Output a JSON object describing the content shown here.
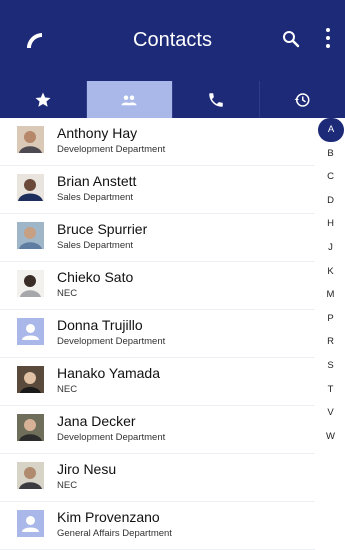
{
  "appbar": {
    "title": "Contacts",
    "call_icon": "call-handset-icon",
    "search_icon": "search-icon",
    "menu_icon": "more-vert-icon",
    "background": "#1d2a78"
  },
  "tabs": [
    {
      "icon": "star-icon",
      "active": false
    },
    {
      "icon": "people-icon",
      "active": true
    },
    {
      "icon": "phone-icon",
      "active": false
    },
    {
      "icon": "history-icon",
      "active": false
    }
  ],
  "contacts": [
    {
      "name": "Anthony Hay",
      "dept": "Development Department",
      "avatar": "photo"
    },
    {
      "name": "Brian Anstett",
      "dept": "Sales Department",
      "avatar": "photo"
    },
    {
      "name": "Bruce Spurrier",
      "dept": "Sales Department",
      "avatar": "photo"
    },
    {
      "name": "Chieko Sato",
      "dept": "NEC",
      "avatar": "photo"
    },
    {
      "name": "Donna Trujillo",
      "dept": "Development Department",
      "avatar": "placeholder"
    },
    {
      "name": "Hanako Yamada",
      "dept": "NEC",
      "avatar": "photo"
    },
    {
      "name": "Jana Decker",
      "dept": "Development Department",
      "avatar": "photo"
    },
    {
      "name": "Jiro Nesu",
      "dept": "NEC",
      "avatar": "photo"
    },
    {
      "name": "Kim Provenzano",
      "dept": "General Affairs Department",
      "avatar": "placeholder"
    }
  ],
  "index_letters": [
    "A",
    "B",
    "C",
    "D",
    "H",
    "J",
    "K",
    "M",
    "P",
    "R",
    "S",
    "T",
    "V",
    "W"
  ],
  "index_active": "A",
  "colors": {
    "primary": "#1d2a78",
    "accent_light": "#a9b8e8"
  }
}
